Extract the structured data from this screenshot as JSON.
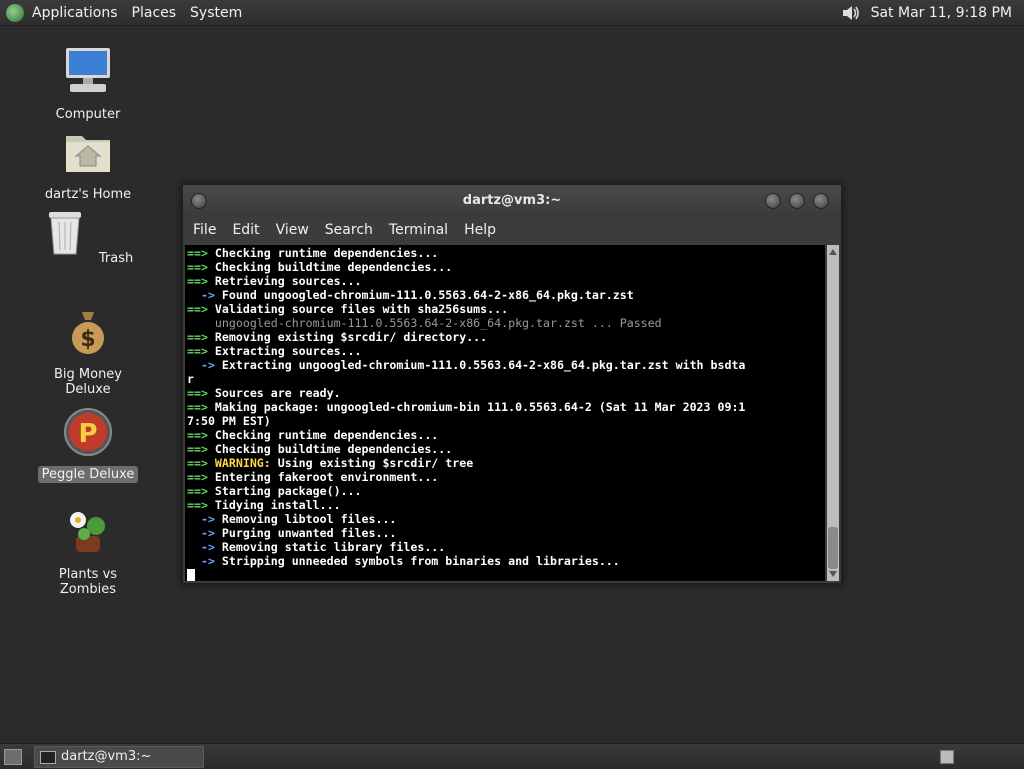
{
  "top_panel": {
    "menus": [
      "Applications",
      "Places",
      "System"
    ],
    "clock": "Sat Mar 11, 9:18 PM"
  },
  "desktop": {
    "icons": [
      {
        "label": "Computer",
        "icon": "computer-icon"
      },
      {
        "label": "dartz's Home",
        "icon": "home-folder-icon"
      },
      {
        "label": "Trash",
        "icon": "trash-icon"
      },
      {
        "label": "Big Money Deluxe",
        "icon": "money-bag-icon"
      },
      {
        "label": "Peggle Deluxe",
        "icon": "peggle-icon",
        "selected": true
      },
      {
        "label": "Plants vs Zombies",
        "icon": "plants-icon"
      }
    ]
  },
  "terminal": {
    "title": "dartz@vm3:~",
    "menu": [
      "File",
      "Edit",
      "View",
      "Search",
      "Terminal",
      "Help"
    ],
    "lines": [
      {
        "prefix": "==> ",
        "pc": "g",
        "text": "Checking runtime dependencies..."
      },
      {
        "prefix": "==> ",
        "pc": "g",
        "text": "Checking buildtime dependencies..."
      },
      {
        "prefix": "==> ",
        "pc": "g",
        "text": "Retrieving sources..."
      },
      {
        "prefix": "  -> ",
        "pc": "b",
        "text": "Found ungoogled-chromium-111.0.5563.64-2-x86_64.pkg.tar.zst"
      },
      {
        "prefix": "==> ",
        "pc": "g",
        "text": "Validating source files with sha256sums..."
      },
      {
        "prefix": "    ",
        "pc": "",
        "text": "ungoogled-chromium-111.0.5563.64-2-x86_64.pkg.tar.zst ... Passed",
        "dim": true
      },
      {
        "prefix": "==> ",
        "pc": "g",
        "text": "Removing existing $srcdir/ directory..."
      },
      {
        "prefix": "==> ",
        "pc": "g",
        "text": "Extracting sources..."
      },
      {
        "prefix": "  -> ",
        "pc": "b",
        "text": "Extracting ungoogled-chromium-111.0.5563.64-2-x86_64.pkg.tar.zst with bsdta"
      },
      {
        "prefix": "",
        "pc": "",
        "text": "r"
      },
      {
        "prefix": "==> ",
        "pc": "g",
        "text": "Sources are ready."
      },
      {
        "prefix": "==> ",
        "pc": "g",
        "text": "Making package: ungoogled-chromium-bin 111.0.5563.64-2 (Sat 11 Mar 2023 09:1"
      },
      {
        "prefix": "",
        "pc": "",
        "text": "7:50 PM EST)"
      },
      {
        "prefix": "==> ",
        "pc": "g",
        "text": "Checking runtime dependencies..."
      },
      {
        "prefix": "==> ",
        "pc": "g",
        "text": "Checking buildtime dependencies..."
      },
      {
        "prefix": "==> ",
        "pc": "g",
        "warn": "WARNING:",
        "text": " Using existing $srcdir/ tree"
      },
      {
        "prefix": "==> ",
        "pc": "g",
        "text": "Entering fakeroot environment..."
      },
      {
        "prefix": "==> ",
        "pc": "g",
        "text": "Starting package()..."
      },
      {
        "prefix": "==> ",
        "pc": "g",
        "text": "Tidying install..."
      },
      {
        "prefix": "  -> ",
        "pc": "b",
        "text": "Removing libtool files..."
      },
      {
        "prefix": "  -> ",
        "pc": "b",
        "text": "Purging unwanted files..."
      },
      {
        "prefix": "  -> ",
        "pc": "b",
        "text": "Removing static library files..."
      },
      {
        "prefix": "  -> ",
        "pc": "b",
        "text": "Stripping unneeded symbols from binaries and libraries..."
      }
    ]
  },
  "bottom_panel": {
    "task_label": "dartz@vm3:~"
  },
  "colors": {
    "arrow_green": "#67d667",
    "arrow_blue": "#6aa9ff",
    "warning_yellow": "#ffd84a",
    "desktop_bg": "#2b2b2b"
  }
}
